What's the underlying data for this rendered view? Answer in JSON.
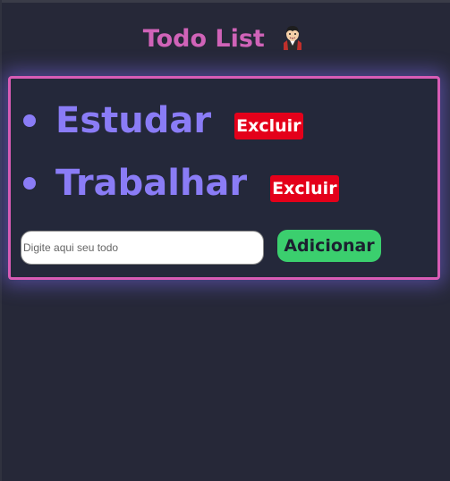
{
  "header": {
    "title": "Todo List",
    "emoji_icon": "vampire-emoji-icon"
  },
  "todos": [
    {
      "text": "Estudar",
      "delete_label": "Excluir"
    },
    {
      "text": "Trabalhar",
      "delete_label": "Excluir"
    }
  ],
  "form": {
    "input_placeholder": "Digite aqui seu todo",
    "input_value": "",
    "add_label": "Adicionar"
  },
  "colors": {
    "background": "#262838",
    "title": "#d063b8",
    "panel_border": "#d85cb5",
    "todo_text": "#8a7cf6",
    "delete_button": "#e4001a",
    "add_button": "#3bcf6e"
  }
}
